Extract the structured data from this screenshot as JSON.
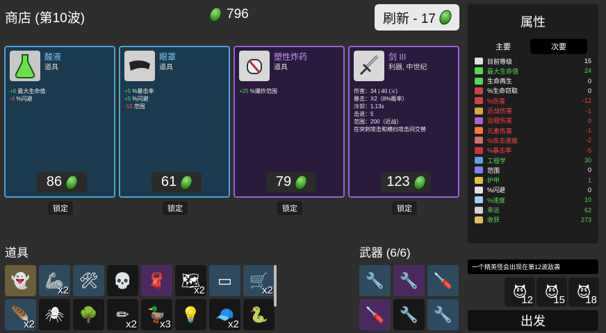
{
  "header": {
    "title": "商店 (第10波)",
    "currency": "796",
    "reroll_label": "刷新 - 17"
  },
  "cards": [
    {
      "name": "酸液",
      "type": "道具",
      "icon": "acid-flask-icon",
      "stats": [
        [
          "+8",
          "g",
          " 最大生命值"
        ],
        [
          "-4",
          "r",
          " %闪避"
        ]
      ],
      "price": "86",
      "lock": "锁定"
    },
    {
      "name": "眼罩",
      "type": "道具",
      "icon": "blindfold-icon",
      "stats": [
        [
          "+5",
          "g",
          " %暴击率"
        ],
        [
          "+5",
          "g",
          " %闪避"
        ],
        [
          "-15",
          "r",
          " 范围"
        ]
      ],
      "price": "61",
      "lock": "锁定"
    },
    {
      "name": "塑性炸药",
      "type": "道具",
      "icon": "plastic-explosive-icon",
      "stats": [
        [
          "+25",
          "g",
          " %爆炸范围"
        ]
      ],
      "price": "79",
      "lock": "锁定"
    },
    {
      "name": "剑 III",
      "type": "利器, 中世纪",
      "icon": "sword-icon",
      "weapon_stats": [
        "伤害：34 | 40 (⚔)",
        "暴击：X2（8%概率）",
        "冷却：1.13s",
        "击退：5",
        "范围：200（近战）",
        "在突刺攻击和横扫攻击间交替"
      ],
      "price": "123",
      "lock": "锁定"
    }
  ],
  "panel": {
    "title": "属性",
    "tab_primary": "主要",
    "tab_secondary": "次要",
    "stats": [
      {
        "label": "目前等级",
        "value": "15",
        "color": "#ffffff"
      },
      {
        "label": "最大生命值",
        "value": "24",
        "color": "#56d656"
      },
      {
        "label": "生命再生",
        "value": "0",
        "color": "#ffffff"
      },
      {
        "label": "%生命窃取",
        "value": "0",
        "color": "#ffffff"
      },
      {
        "label": "%伤害",
        "value": "-12",
        "color": "#ff4444"
      },
      {
        "label": "近战伤害",
        "value": "-1",
        "color": "#ff4444"
      },
      {
        "label": "远程伤害",
        "value": "0",
        "color": "#ff4444"
      },
      {
        "label": "元素伤害",
        "value": "-1",
        "color": "#ff4444"
      },
      {
        "label": "%攻击速度",
        "value": "-2",
        "color": "#ff4444"
      },
      {
        "label": "%暴击率",
        "value": "-5",
        "color": "#ff4444"
      },
      {
        "label": "工程学",
        "value": "30",
        "color": "#56d656"
      },
      {
        "label": "范围",
        "value": "0",
        "color": "#ffffff"
      },
      {
        "label": "护甲",
        "value": "1",
        "color": "#56d656"
      },
      {
        "label": "%闪避",
        "value": "0",
        "color": "#ffffff"
      },
      {
        "label": "%速度",
        "value": "10",
        "color": "#56d656"
      },
      {
        "label": "幸运",
        "value": "62",
        "color": "#56d656"
      },
      {
        "label": "收获",
        "value": "273",
        "color": "#56d656"
      }
    ]
  },
  "items_section": {
    "title": "道具",
    "row1": [
      {
        "icon": "ghost-icon",
        "count": ""
      },
      {
        "icon": "robot-arm-icon",
        "count": "x2"
      },
      {
        "icon": "turret-icon",
        "count": ""
      },
      {
        "icon": "skull-icon",
        "count": ""
      },
      {
        "icon": "scarf-icon",
        "count": ""
      },
      {
        "icon": "treasure-map-icon",
        "count": "x2"
      },
      {
        "icon": "metal-plate-icon",
        "count": ""
      },
      {
        "icon": "wheelbarrow-icon",
        "count": "x2"
      }
    ],
    "row2": [
      {
        "icon": "feather-icon",
        "count": "x2"
      },
      {
        "icon": "spider-icon",
        "count": ""
      },
      {
        "icon": "tree-icon",
        "count": ""
      },
      {
        "icon": "pencil-icon",
        "count": "x2"
      },
      {
        "icon": "duck-icon",
        "count": "x3"
      },
      {
        "icon": "lamp-icon",
        "count": ""
      },
      {
        "icon": "propeller-hat-icon",
        "count": "x2"
      },
      {
        "icon": "snake-icon",
        "count": ""
      }
    ]
  },
  "weapons_section": {
    "title": "武器 (6/6)"
  },
  "notice": "一个精英怪会出现在第12波敌袭",
  "enemies": [
    "12",
    "15",
    "18"
  ],
  "go_label": "出发"
}
